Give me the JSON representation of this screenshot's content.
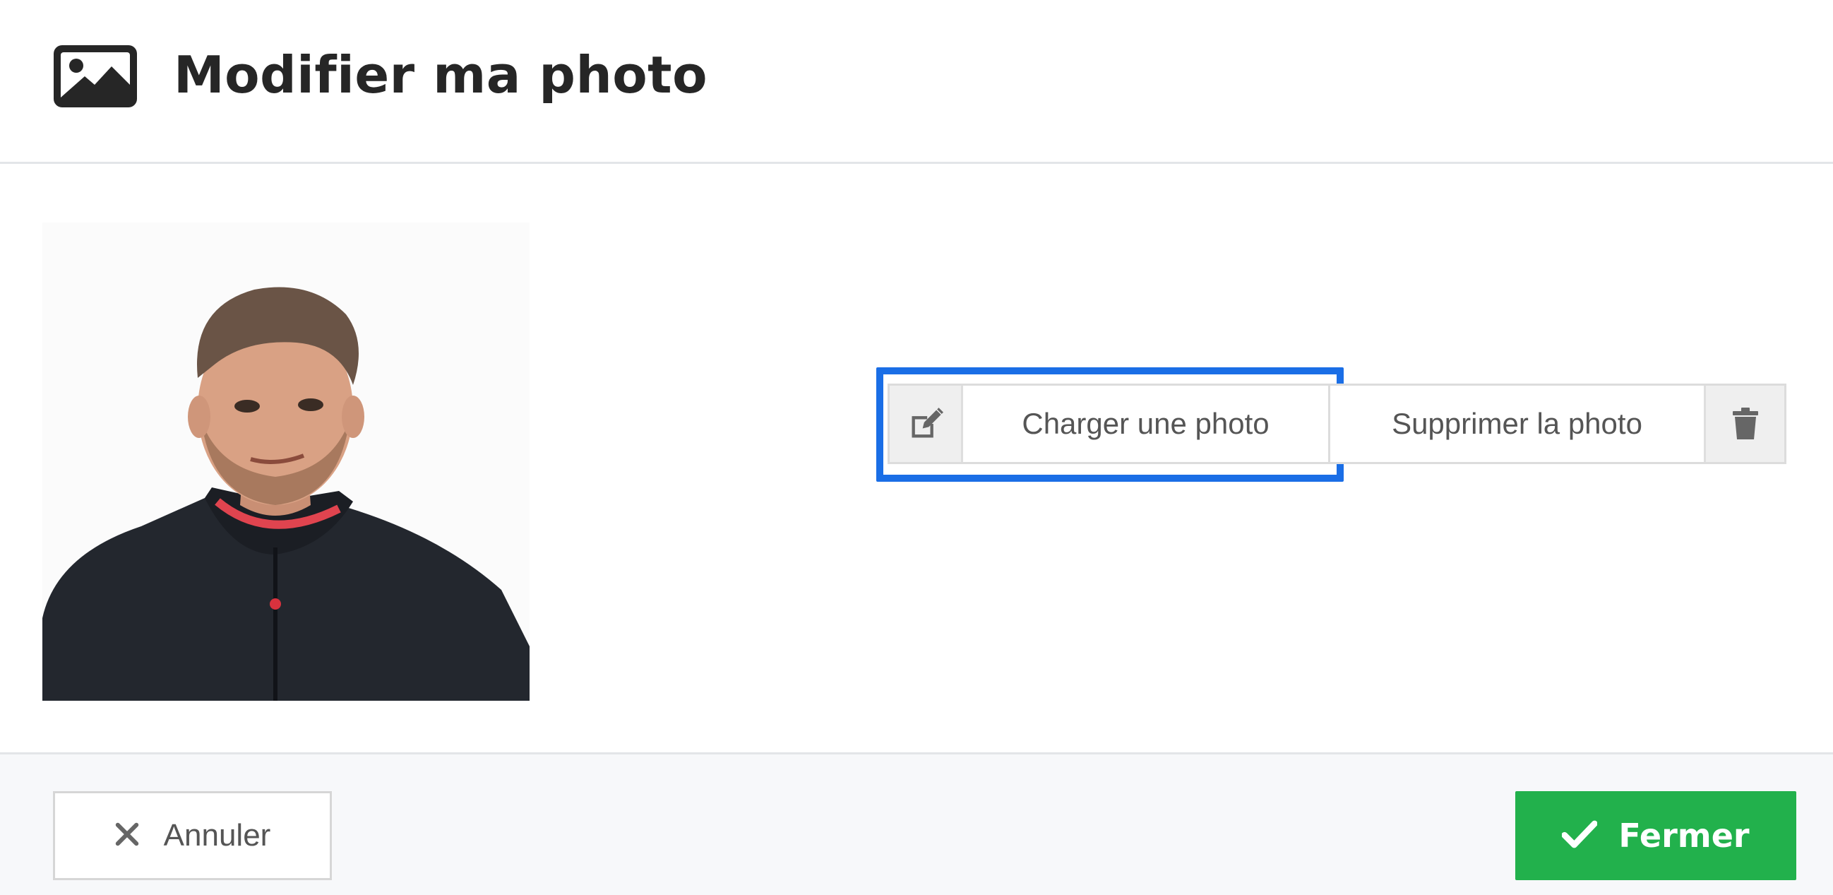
{
  "dialog": {
    "title": "Modifier ma photo",
    "title_icon": "image-icon"
  },
  "photo": {
    "alt": "Profile photo"
  },
  "actions": {
    "upload_label": "Charger une photo",
    "upload_icon": "edit-icon",
    "delete_label": "Supprimer la photo",
    "delete_icon": "trash-icon"
  },
  "footer": {
    "cancel_label": "Annuler",
    "cancel_icon": "close-icon",
    "close_label": "Fermer",
    "close_icon": "check-icon"
  },
  "colors": {
    "highlight": "#1a6ee6",
    "primary_button": "#22b14c"
  }
}
